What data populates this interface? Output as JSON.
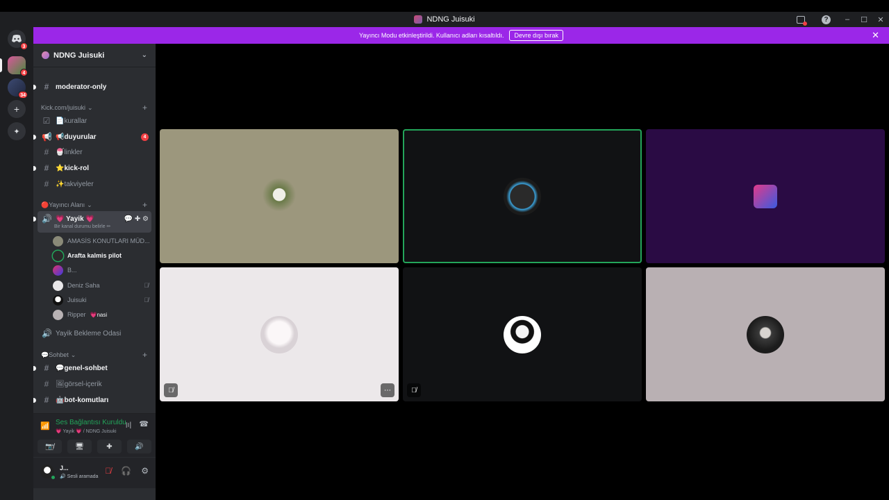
{
  "window": {
    "title": "NDNG Juisuki",
    "controls": {
      "minimize": "–",
      "maximize": "☐",
      "close": "✕"
    }
  },
  "guilds": {
    "home_badge": "3",
    "server1_badge": "4",
    "server2_badge": "34",
    "add_server": "+",
    "discover": "✦"
  },
  "banner": {
    "text": "Yayıncı Modu etkinleştirildi. Kullanıcı adları kısaltıldı.",
    "button": "Devre dışı bırak",
    "close": "✕"
  },
  "server": {
    "name": "NDNG Juisuki",
    "channels": [
      {
        "name": "moderator-only"
      }
    ],
    "category_kick": "Kick.com/juisuki",
    "kick_channels": [
      {
        "name": "📄kurallar"
      },
      {
        "name": "📢duyurular",
        "badge": "4"
      },
      {
        "name": "🍧linkler"
      },
      {
        "name": "⭐kick-rol"
      },
      {
        "name": "✨takviyeler"
      }
    ],
    "category_voice": "🔴Yayıncı Alanı",
    "voice_channel": {
      "name": "💗 Yayik 💗",
      "status": "Bir kanal durumu belirle ✏"
    },
    "voice_users": [
      {
        "name": "AMASİS KONUTLARI MÜD..."
      },
      {
        "name": "Arafta kalmis pilot"
      },
      {
        "name": "B..."
      },
      {
        "name": "Deniz Saha",
        "muted": "🎙̸"
      },
      {
        "name": "Juisuki",
        "muted": "🎙̸"
      },
      {
        "name": "Ripper",
        "tag": "💗nasi"
      }
    ],
    "waiting_room": "Yayik Bekleme Odasi",
    "category_chat": "💬Sohbet",
    "chat_channels": [
      {
        "name": "💬genel-sohbet"
      },
      {
        "name": "🖼görsel-içerik"
      },
      {
        "name": "🤖bot-komutları"
      }
    ]
  },
  "voice_panel": {
    "status": "Ses Bağlantısı Kuruldu",
    "location": "💗 Yayik 💗 / NDNG Juisuki",
    "buttons": {
      "camera": "📷̸",
      "screen": "🖥",
      "activities": "✚",
      "soundboard": "🔊"
    }
  },
  "user_panel": {
    "name": "J...",
    "sub": "🔊 Sesli aramada",
    "ctrl_mute": "🎙̸",
    "ctrl_deafen": "🎧",
    "ctrl_settings": "⚙"
  },
  "tiles": {
    "tile4_corner_left": "🎙̸",
    "tile4_corner_right": "⋯",
    "tile5_corner_left": "🎙̸"
  },
  "colors": {
    "accent_banner": "#9b27e8",
    "speaking_ring": "#23a55a",
    "badge_red": "#f23f43"
  }
}
